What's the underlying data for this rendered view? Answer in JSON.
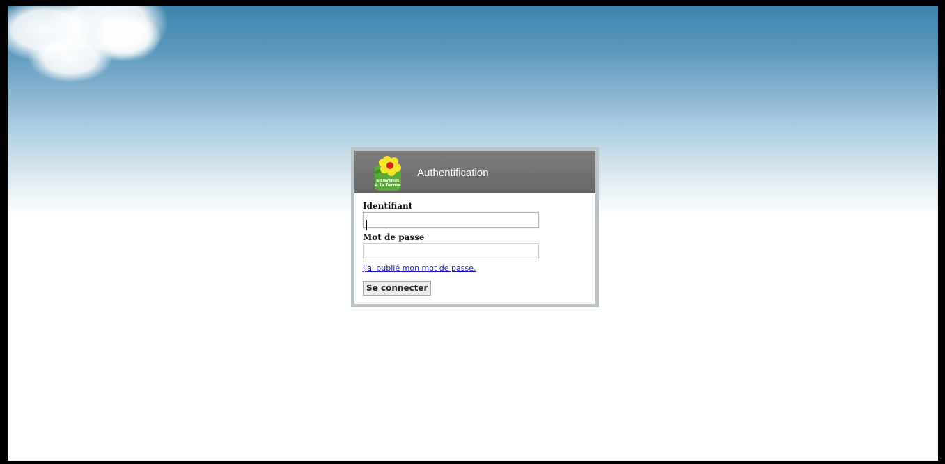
{
  "header": {
    "title": "Authentification",
    "logo_text_line1": "BIENVENUE",
    "logo_text_line2": "à la ferme"
  },
  "form": {
    "username_label": "Identifiant",
    "username_value": "",
    "password_label": "Mot de passe",
    "password_value": "",
    "forgot_link": "J'ai oublié mon mot de passe.",
    "submit_label": "Se connecter"
  },
  "colors": {
    "header_bg": "#707070",
    "box_border": "#b9c3c8",
    "link": "#1a1ab8",
    "sky_top": "#3e83ab"
  },
  "icons": [
    "flower-logo-icon"
  ]
}
